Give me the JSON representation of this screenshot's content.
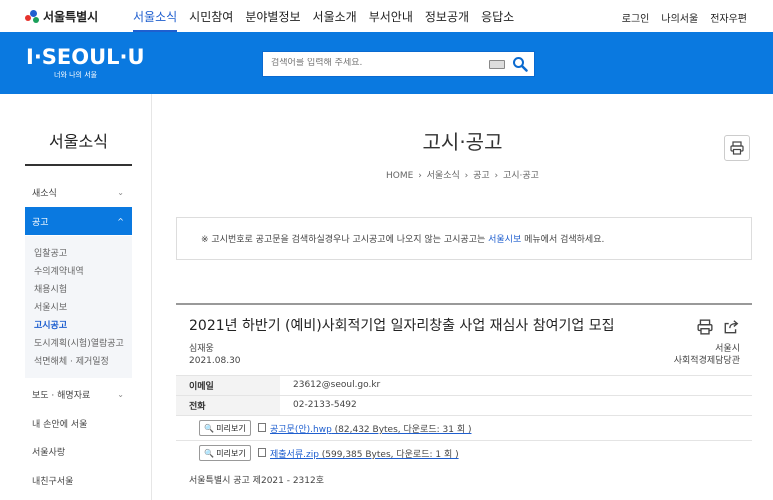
{
  "header": {
    "logo_text": "서울특별시",
    "nav": [
      "서울소식",
      "시민참여",
      "분야별정보",
      "서울소개",
      "부서안내",
      "정보공개",
      "응답소"
    ],
    "util": [
      "로그인",
      "나의서울",
      "전자우편"
    ]
  },
  "banner": {
    "brand": "I·SEOUL·U",
    "brand_sub": "너와 나의 서울",
    "search_placeholder": "검색어를 입력해 주세요."
  },
  "sidebar": {
    "title": "서울소식",
    "items": [
      {
        "label": "새소식"
      },
      {
        "label": "공고"
      },
      {
        "label": "보도 · 해명자료"
      },
      {
        "label": "내 손안에 서울"
      },
      {
        "label": "서울사랑"
      },
      {
        "label": "내친구서울"
      }
    ],
    "sub_items": [
      "입찰공고",
      "수의계약내역",
      "채용시험",
      "서울시보",
      "고시공고",
      "도시계획(시험)열람공고",
      "석면해체 · 제거일정"
    ]
  },
  "page": {
    "title": "고시·공고",
    "breadcrumb": "HOME  ›  서울소식  ›  공고  ›  고시·공고"
  },
  "notice": {
    "prefix": "※ 고시번호로 공고문을 검색하실경우나 고시공고에 나오지 않는 고시공고는 ",
    "link": "서울시보",
    "suffix": " 메뉴에서 검색하세요."
  },
  "article": {
    "title": "2021년 하반기 (예비)사회적기업 일자리창출 사업 재심사 참여기업 모집",
    "author": "심재웅",
    "date": "2021.08.30",
    "org": "서울시",
    "dept": "사회적경제담당관",
    "email_label": "이메일",
    "email": "23612@seoul.go.kr",
    "phone_label": "전화",
    "phone": "02-2133-5492",
    "preview_label": "미리보기",
    "attachments": [
      {
        "name": "공고문(안).hwp",
        "info": " (82,432 Bytes, 다운로드: 31 회 )"
      },
      {
        "name": "제출서류.zip",
        "info": " (599,385 Bytes, 다운로드: 1 회 )"
      }
    ],
    "notice_no": "서울특별시 공고 제2021 - 2312호"
  }
}
